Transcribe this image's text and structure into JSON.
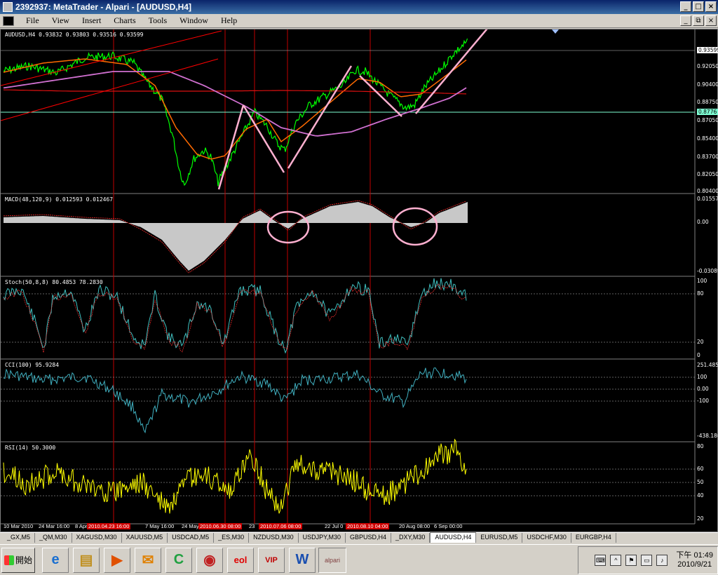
{
  "window": {
    "title": "2392937: MetaTrader - Alpari - [AUDUSD,H4]",
    "buttons": [
      "_",
      "□",
      "×"
    ]
  },
  "menu": [
    "File",
    "View",
    "Insert",
    "Charts",
    "Tools",
    "Window",
    "Help"
  ],
  "mdi_buttons": [
    "_",
    "⧉",
    "×"
  ],
  "panels": {
    "main": {
      "label": "AUDUSD,H4 0.93832 0.93803 0.93516 0.93599",
      "axis": [
        "0.93599",
        "0.92050",
        "0.90400",
        "0.88750",
        "0.8776",
        "0.87050",
        "0.85400",
        "0.83700",
        "0.82050",
        "0.80400"
      ]
    },
    "macd": {
      "label": "MACD(48,120,9) 0.012593 0.012467",
      "axis": [
        "0.015571",
        "0.00",
        "-0.03089"
      ]
    },
    "stoch": {
      "label": "Stoch(50,8,8) 80.4853 78.2830",
      "axis": [
        "100",
        "80",
        "20",
        "0"
      ]
    },
    "cci": {
      "label": "CCI(100) 95.9284",
      "axis": [
        "251.4857",
        "100",
        "0.00",
        "-100",
        "-438.186"
      ]
    },
    "rsi": {
      "label": "RSI(14) 50.3000",
      "axis": [
        "80",
        "60",
        "50",
        "40",
        "20"
      ]
    }
  },
  "dates": [
    {
      "text": "10 Mar 2010",
      "hl": false
    },
    {
      "text": "24 Mar 16:00",
      "hl": false
    },
    {
      "text": "8 Apr",
      "hl": false
    },
    {
      "text": "2010.04.23 16:00",
      "hl": true
    },
    {
      "text": "7 May 16:00",
      "hl": false
    },
    {
      "text": "24 May",
      "hl": false
    },
    {
      "text": "2010.06.30 08:00",
      "hl": true
    },
    {
      "text": "23",
      "hl": false
    },
    {
      "text": "2010.07.06 08:00",
      "hl": true
    },
    {
      "text": "22 Jul 0",
      "hl": false
    },
    {
      "text": "2010.08.10 04:00",
      "hl": true
    },
    {
      "text": "20 Aug 08:00",
      "hl": false
    },
    {
      "text": "6 Sep 00:00",
      "hl": false
    }
  ],
  "tabs": [
    "_GX,M5",
    "_QM,M30",
    "XAGUSD,M30",
    "XAUUSD,M5",
    "USDCAD,M5",
    "_ES,M30",
    "NZDUSD,M30",
    "USDJPY,M30",
    "GBPUSD,H4",
    "_DXY,M30",
    "AUDUSD,H4",
    "EURUSD,M5",
    "USDCHF,M30",
    "EURGBP,H4"
  ],
  "active_tab": "AUDUSD,H4",
  "taskbar": {
    "start_label": "開始",
    "quick_launch": [
      "e",
      "▤",
      "▶",
      "✉",
      "C",
      "◉",
      "eol",
      "VIP",
      "W",
      "alpari"
    ],
    "clock_line1": "下午 01:49",
    "clock_line2": "2010/9/21"
  }
}
